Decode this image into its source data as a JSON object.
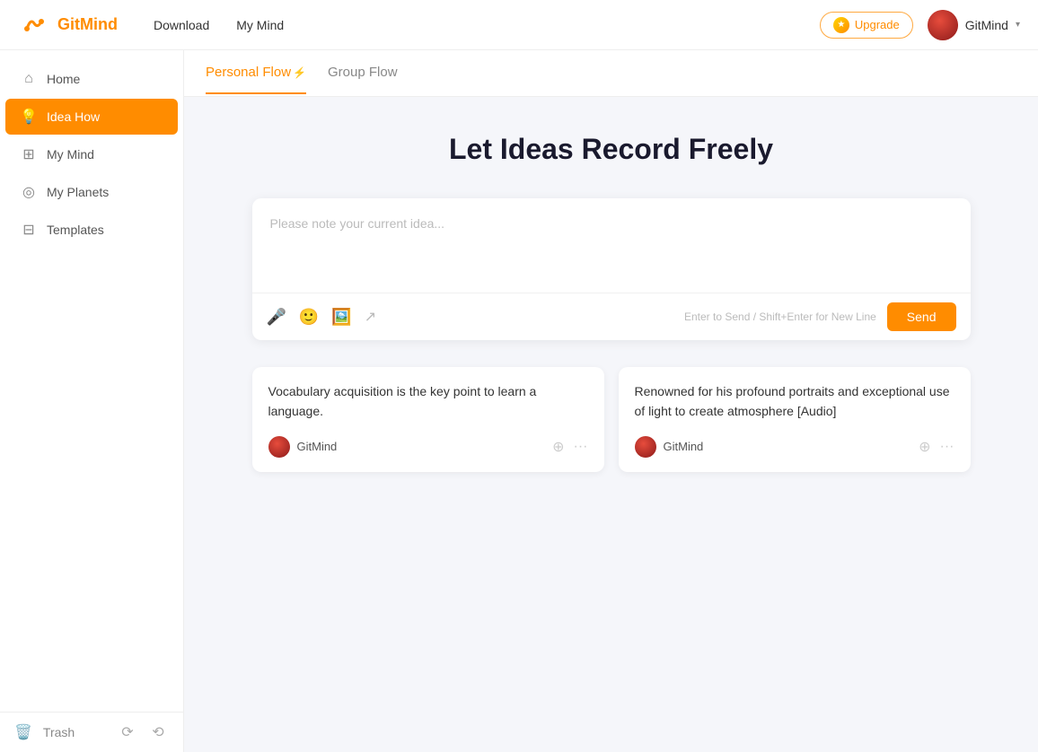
{
  "app": {
    "name": "GitMind",
    "logo_text": "GitMind"
  },
  "topnav": {
    "download_label": "Download",
    "mymind_label": "My Mind",
    "upgrade_label": "Upgrade",
    "user_name": "GitMind",
    "chevron": "▾"
  },
  "sidebar": {
    "items": [
      {
        "id": "home",
        "label": "Home",
        "icon": "⌂",
        "active": false
      },
      {
        "id": "idea-flow",
        "label": "Idea How",
        "icon": "💡",
        "active": true
      },
      {
        "id": "my-mind",
        "label": "My Mind",
        "icon": "⊞",
        "active": false
      },
      {
        "id": "my-planets",
        "label": "My Planets",
        "icon": "◎",
        "active": false
      },
      {
        "id": "templates",
        "label": "Templates",
        "icon": "⊟",
        "active": false
      }
    ],
    "bottom": {
      "trash_label": "Trash",
      "icon1": "↻",
      "icon2": "↺"
    }
  },
  "tabs": [
    {
      "id": "personal-flow",
      "label": "Personal Flow",
      "active": true,
      "lightning": "⚡"
    },
    {
      "id": "group-flow",
      "label": "Group Flow",
      "active": false
    }
  ],
  "main": {
    "title": "Let Ideas Record Freely",
    "input": {
      "placeholder": "Please note your current idea...",
      "hint": "Enter to Send / Shift+Enter for New Line",
      "send_label": "Send",
      "toolbar_icons": [
        "🎤",
        "😊",
        "🖼️",
        "↗️"
      ]
    },
    "ideas": [
      {
        "id": "idea1",
        "text": "Vocabulary acquisition is the key point to learn a language.",
        "user": "GitMind"
      },
      {
        "id": "idea2",
        "text": "Renowned for his profound portraits and exceptional use of light to create atmosphere [Audio]",
        "user": "GitMind"
      }
    ]
  }
}
